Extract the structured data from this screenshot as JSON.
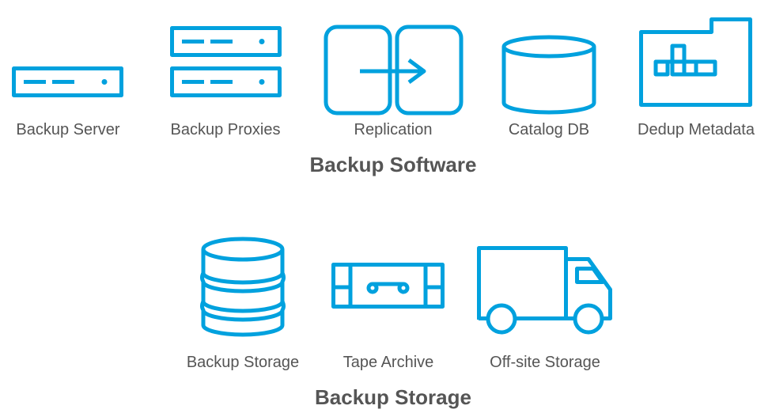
{
  "accent_color": "#00a1de",
  "text_color": "#555555",
  "groups": [
    {
      "title": "Backup Software",
      "items": [
        {
          "label": "Backup Server",
          "icon": "server-icon"
        },
        {
          "label": "Backup Proxies",
          "icon": "server-stack-icon"
        },
        {
          "label": "Replication",
          "icon": "replication-icon"
        },
        {
          "label": "Catalog DB",
          "icon": "database-icon"
        },
        {
          "label": "Dedup Metadata",
          "icon": "folder-blocks-icon"
        }
      ]
    },
    {
      "title": "Backup Storage",
      "items": [
        {
          "label": "Backup Storage",
          "icon": "database-stack-icon"
        },
        {
          "label": "Tape Archive",
          "icon": "tape-icon"
        },
        {
          "label": "Off-site Storage",
          "icon": "truck-icon"
        }
      ]
    }
  ]
}
